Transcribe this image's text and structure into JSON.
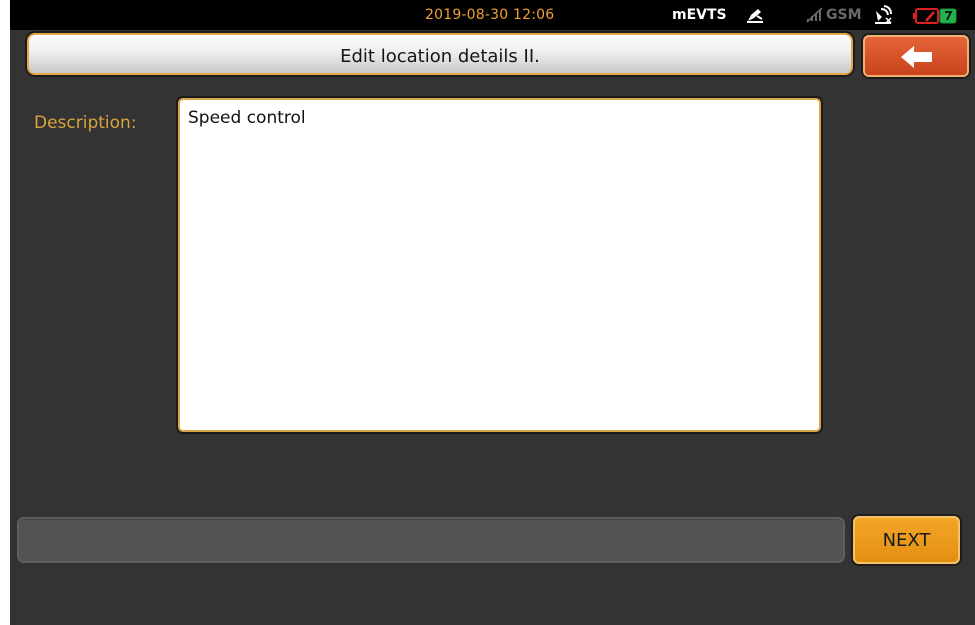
{
  "status_bar": {
    "datetime": "2019-08-30 12:06",
    "app_name": "mEVTS",
    "network": "GSM",
    "icons": [
      "edit-icon",
      "no-signal-icon",
      "gps-off-icon",
      "battery-icon"
    ],
    "colors": {
      "datetime": "#f0a030",
      "battery_low": "#e02020",
      "battery_charge": "#22b14c"
    }
  },
  "header": {
    "title": "Edit location details II."
  },
  "back_button": {
    "icon": "back-arrow-icon",
    "color": "#d24e25"
  },
  "form": {
    "description_label": "Description:",
    "description_value": "Speed control",
    "accent_color": "#d9a33e"
  },
  "footer": {
    "message": "",
    "next_label": "NEXT",
    "next_color": "#f0a020"
  }
}
